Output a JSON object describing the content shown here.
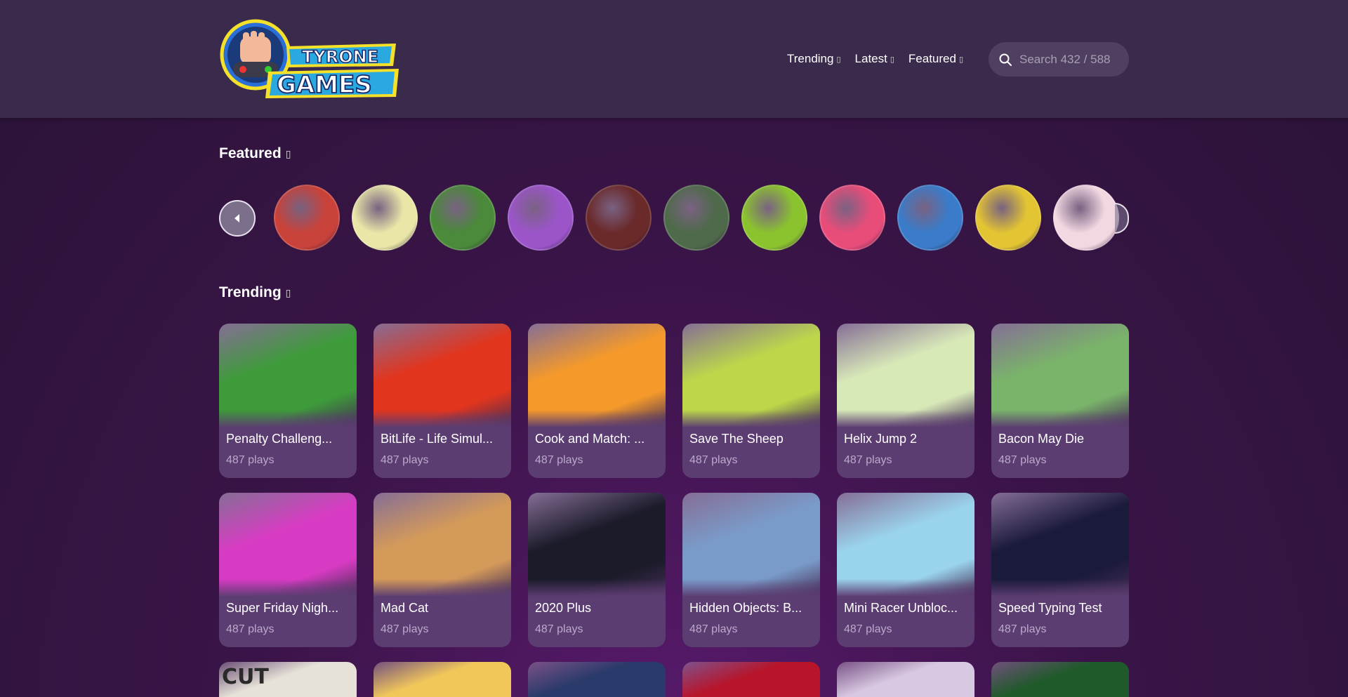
{
  "header": {
    "logo_text_line1": "TYRONE",
    "logo_text_line2": "GAMES",
    "nav": [
      {
        "label": "Trending"
      },
      {
        "label": "Latest"
      },
      {
        "label": "Featured"
      }
    ],
    "search": {
      "placeholder": "Search 432 / 588"
    }
  },
  "featured": {
    "title": "Featured",
    "items": [
      {
        "name": "featured-game-1",
        "color": "#c8423a"
      },
      {
        "name": "featured-game-2",
        "color": "#e9e6a8"
      },
      {
        "name": "featured-game-3",
        "color": "#4a8a3a"
      },
      {
        "name": "featured-game-4",
        "color": "#9b55c9"
      },
      {
        "name": "featured-game-5",
        "color": "#6a2a2a"
      },
      {
        "name": "featured-game-6",
        "color": "#4f6a4a"
      },
      {
        "name": "featured-game-7",
        "color": "#8bc32f"
      },
      {
        "name": "featured-game-8",
        "color": "#e84d7a"
      },
      {
        "name": "featured-game-9",
        "color": "#3a7cc9"
      },
      {
        "name": "featured-game-10",
        "color": "#e3c433"
      },
      {
        "name": "featured-game-11",
        "color": "#f3d8e2"
      }
    ]
  },
  "trending": {
    "title": "Trending",
    "games": [
      {
        "title": "Penalty Challeng...",
        "plays": "487 plays",
        "color": "#3e9b3a"
      },
      {
        "title": "BitLife - Life Simul...",
        "plays": "487 plays",
        "color": "#e2351d"
      },
      {
        "title": "Cook and Match: ...",
        "plays": "487 plays",
        "color": "#f59a2a"
      },
      {
        "title": "Save The Sheep",
        "plays": "487 plays",
        "color": "#bcd84a"
      },
      {
        "title": "Helix Jump 2",
        "plays": "487 plays",
        "color": "#d8e9b8"
      },
      {
        "title": "Bacon May Die",
        "plays": "487 plays",
        "color": "#7ab36a"
      },
      {
        "title": "Super Friday Nigh...",
        "plays": "487 plays",
        "color": "#d83bc3"
      },
      {
        "title": "Mad Cat",
        "plays": "487 plays",
        "color": "#d49a5a"
      },
      {
        "title": "2020 Plus",
        "plays": "487 plays",
        "color": "#1b1b2a"
      },
      {
        "title": "Hidden Objects: B...",
        "plays": "487 plays",
        "color": "#7a9bc9"
      },
      {
        "title": "Mini Racer Unbloc...",
        "plays": "487 plays",
        "color": "#9ad3ec"
      },
      {
        "title": "Speed Typing Test",
        "plays": "487 plays",
        "color": "#1a1a3a"
      }
    ],
    "partial_row": [
      {
        "color": "#e6e2d8"
      },
      {
        "color": "#f1c75a"
      },
      {
        "color": "#2a3a6a"
      },
      {
        "color": "#b8142a"
      },
      {
        "color": "#d8c9e2"
      },
      {
        "color": "#1f5a2a"
      }
    ],
    "partial_label": "CUT"
  }
}
